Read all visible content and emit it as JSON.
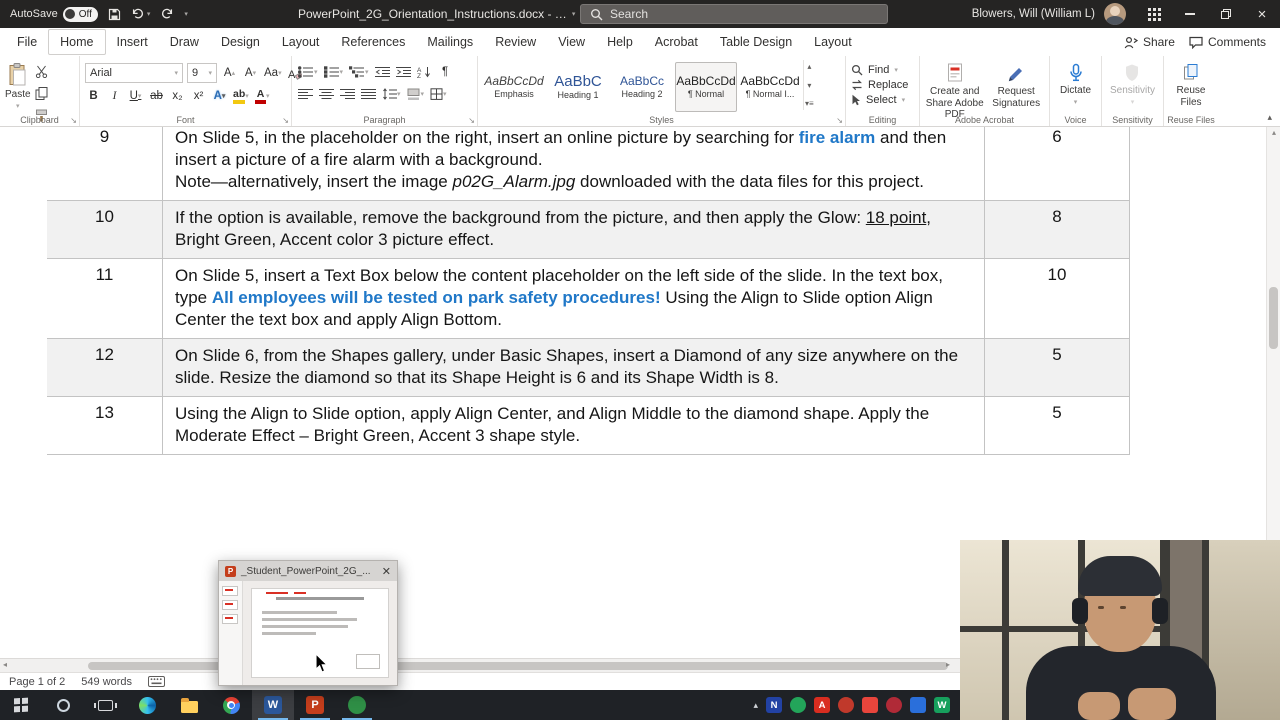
{
  "colors": {
    "titlebar_bg": "#252423",
    "accent_text_blue": "#2078c8",
    "row_shading": "#f1f1f1",
    "word_blue": "#2b579a",
    "powerpoint_red": "#c43e1c",
    "taskbar_bg": "#1f2226"
  },
  "title_bar": {
    "autosave_label": "AutoSave",
    "autosave_state": "Off",
    "document_title": "PowerPoint_2G_Orientation_Instructions.docx - …",
    "search_placeholder": "Search",
    "user_name": "Blowers, Will (William L)"
  },
  "tabs": {
    "items": [
      {
        "label": "File"
      },
      {
        "label": "Home",
        "selected": true
      },
      {
        "label": "Insert"
      },
      {
        "label": "Draw"
      },
      {
        "label": "Design"
      },
      {
        "label": "Layout"
      },
      {
        "label": "References"
      },
      {
        "label": "Mailings"
      },
      {
        "label": "Review"
      },
      {
        "label": "View"
      },
      {
        "label": "Help"
      },
      {
        "label": "Acrobat"
      },
      {
        "label": "Table Design"
      },
      {
        "label": "Layout"
      }
    ],
    "share_label": "Share",
    "comments_label": "Comments"
  },
  "ribbon": {
    "paste_label": "Paste",
    "font_name": "Arial",
    "font_size": "9",
    "styles": [
      {
        "preview": "AaBbCcDd",
        "name": "Emphasis"
      },
      {
        "preview": "AaBbC",
        "name": "Heading 1"
      },
      {
        "preview": "AaBbCc",
        "name": "Heading 2"
      },
      {
        "preview": "AaBbCcDd",
        "name": "¶ Normal",
        "selected": true
      },
      {
        "preview": "AaBbCcDd",
        "name": "¶ Normal I..."
      }
    ],
    "find_label": "Find",
    "replace_label": "Replace",
    "select_label": "Select",
    "acrobat_create_label": "Create and Share Adobe PDF",
    "acrobat_request_label": "Request Signatures",
    "dictate_label": "Dictate",
    "sensitivity_label": "Sensitivity",
    "reuse_label": "Reuse Files",
    "group_labels": {
      "clipboard": "Clipboard",
      "font": "Font",
      "paragraph": "Paragraph",
      "styles": "Styles",
      "editing": "Editing",
      "adobe": "Adobe Acrobat",
      "voice": "Voice",
      "sensitivity": "Sensitivity",
      "reuse": "Reuse Files"
    }
  },
  "document": {
    "rows": [
      {
        "number": "9",
        "points": "6",
        "paragraphs": [
          [
            {
              "t": "On Slide 5, in the placeholder on the right, insert an online picture by searching for "
            },
            {
              "t": "fire alarm",
              "s": "bluebold"
            },
            {
              "t": " and then insert a picture of a fire alarm with a background."
            }
          ],
          [
            {
              "t": "Note—alternatively, insert the image "
            },
            {
              "t": "p02G_Alarm.jpg",
              "s": "italic"
            },
            {
              "t": " downloaded with the data files for this project."
            }
          ]
        ]
      },
      {
        "number": "10",
        "points": "8",
        "paragraphs": [
          [
            {
              "t": "If the option is available, remove the background from the picture, and then apply the Glow: "
            },
            {
              "t": "18 point",
              "s": "underline"
            },
            {
              "t": ", Bright Green, Accent color 3 picture effect."
            }
          ]
        ]
      },
      {
        "number": "11",
        "points": "10",
        "paragraphs": [
          [
            {
              "t": "On Slide 5, insert a Text Box below the content placeholder on the left side of the slide. In the text box, type "
            },
            {
              "t": "All employees will be tested on park safety procedures!",
              "s": "bluebold"
            },
            {
              "t": " Using the Align to Slide option Align Center the text box and apply Align Bottom."
            }
          ]
        ]
      },
      {
        "number": "12",
        "points": "5",
        "paragraphs": [
          [
            {
              "t": "On Slide 6, from the Shapes gallery, under Basic Shapes, insert a Diamond of any size anywhere on the slide. Resize the diamond so that its Shape Height is 6 and its Shape Width is 8."
            }
          ]
        ]
      },
      {
        "number": "13",
        "points": "5",
        "paragraphs": [
          [
            {
              "t": "Using the Align to Slide option, apply Align Center, and Align Middle to the diamond shape. Apply the Moderate Effect – Bright Green, Accent 3 shape style."
            }
          ]
        ]
      }
    ]
  },
  "popup": {
    "title": "_Student_PowerPoint_2G_...",
    "app_glyph": "P",
    "close_glyph": "✕"
  },
  "status": {
    "page_indicator": "Page 1 of 2",
    "word_count": "549 words"
  },
  "taskbar": {
    "office_apps": [
      {
        "name": "word-taskbar-icon",
        "glyph": "W",
        "color": "#2b579a",
        "state": "focused"
      },
      {
        "name": "powerpoint-taskbar-icon",
        "glyph": "P",
        "color": "#c43e1c",
        "state": "running"
      },
      {
        "name": "green-app-taskbar-icon",
        "glyph": "",
        "color": "#2f8f46",
        "state": "running"
      }
    ],
    "tray_icons": [
      {
        "name": "onenote-tray-icon",
        "glyph": "N",
        "color": "#2242a4",
        "shape": "square"
      },
      {
        "name": "green-tray-icon",
        "glyph": "",
        "color": "#23a55a",
        "shape": "circle"
      },
      {
        "name": "adobe-acrobat-tray-icon",
        "glyph": "A",
        "color": "#d92d20",
        "shape": "square"
      },
      {
        "name": "red-tray-icon-1",
        "glyph": "",
        "color": "#c0392b",
        "shape": "circle"
      },
      {
        "name": "red-tray-icon-2",
        "glyph": "",
        "color": "#e8453c",
        "shape": "square"
      },
      {
        "name": "red-tray-icon-3",
        "glyph": "",
        "color": "#b02a37",
        "shape": "circle"
      },
      {
        "name": "blue-tray-icon",
        "glyph": "",
        "color": "#2a6fdb",
        "shape": "square"
      },
      {
        "name": "teal-tray-icon",
        "glyph": "W",
        "color": "#17a05d",
        "shape": "square"
      }
    ]
  }
}
